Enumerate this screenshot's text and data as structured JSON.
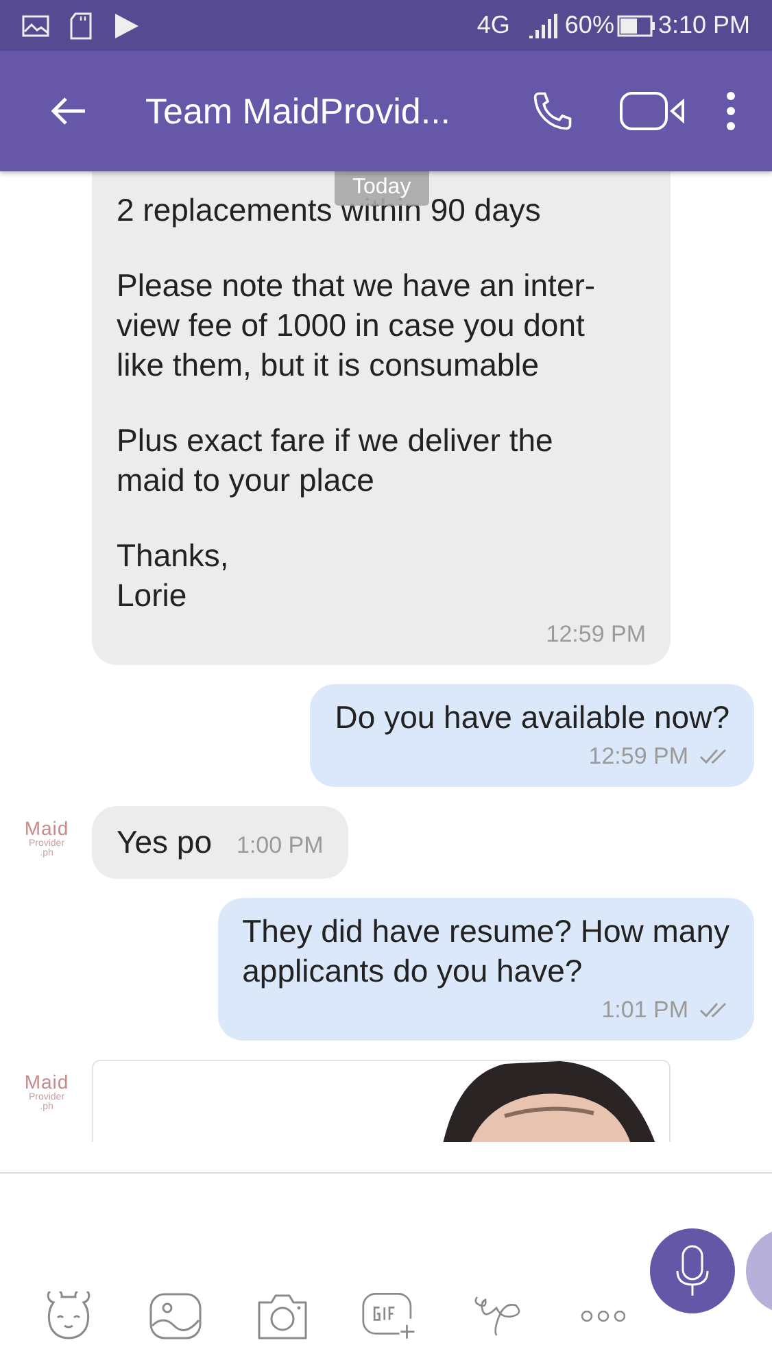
{
  "status_bar": {
    "network": "4G",
    "battery": "60%",
    "time": "3:10 PM"
  },
  "header": {
    "title": "Team MaidProvid..."
  },
  "date_chip": "Today",
  "messages": [
    {
      "kind": "incoming",
      "paragraphs": [
        "2 replacements within 90 days",
        "Please note that we have an inter-\nview fee of 1000 in case you dont\nlike them, but it is consumable",
        "Plus exact fare if we deliver the\nmaid to your place",
        "Thanks,\nLorie"
      ],
      "time": "12:59 PM"
    },
    {
      "kind": "outgoing",
      "paragraphs": [
        "Do you have available now?"
      ],
      "time": "12:59 PM"
    },
    {
      "kind": "incoming_short",
      "avatar_logo": [
        "Maid",
        "Provider",
        ".ph"
      ],
      "paragraphs": [
        "Yes po"
      ],
      "time": "1:00 PM"
    },
    {
      "kind": "outgoing",
      "paragraphs": [
        "They did have resume? How many\napplicants do you have?"
      ],
      "time": "1:01 PM"
    },
    {
      "kind": "incoming_image",
      "avatar_logo": [
        "Maid",
        "Provider",
        ".ph"
      ]
    }
  ]
}
